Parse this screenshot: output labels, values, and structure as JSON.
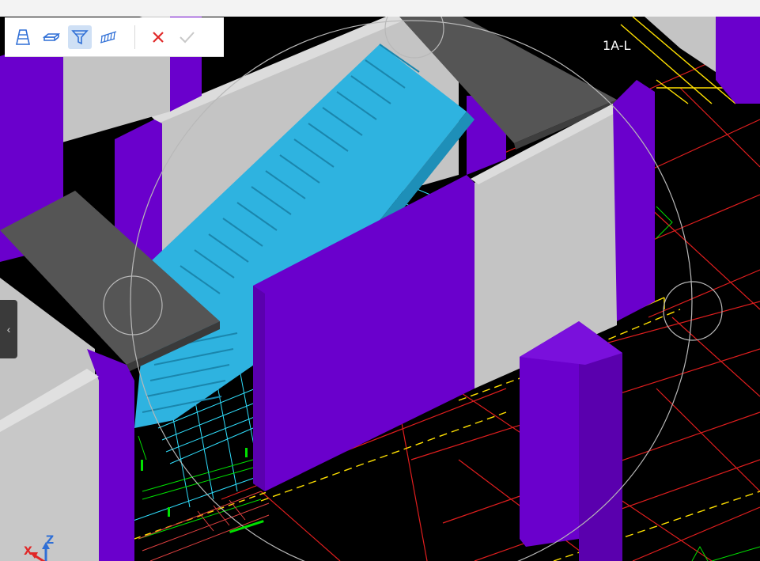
{
  "toolbar": {
    "buttons": [
      {
        "icon": "stair-flight-icon",
        "active": false
      },
      {
        "icon": "landing-slab-icon",
        "active": false
      },
      {
        "icon": "funnel-filter-icon",
        "active": true
      },
      {
        "icon": "railing-icon",
        "active": false
      }
    ],
    "cancel_icon": "close-icon",
    "confirm_icon": "checkmark-icon",
    "colors": {
      "accent": "#2f6fd6",
      "cancel": "#e02828",
      "confirm_disabled": "#c8c8c8",
      "active_bg": "#cfe0f5"
    }
  },
  "viewport": {
    "grid_label": "1A-L",
    "side_handle_icon": "chevron-left-icon",
    "axis": {
      "x": "X",
      "z": "Z"
    },
    "colors": {
      "background": "#000000",
      "wall_purple": "#6a00cc",
      "wall_gray": "#c4c4c4",
      "stair_blue": "#2eb3e0",
      "slab_dark": "#505050",
      "grid_red": "#e01e1e",
      "grid_cyan": "#30e0ff",
      "grid_yellow": "#ffe000",
      "grid_green": "#00e000"
    }
  }
}
